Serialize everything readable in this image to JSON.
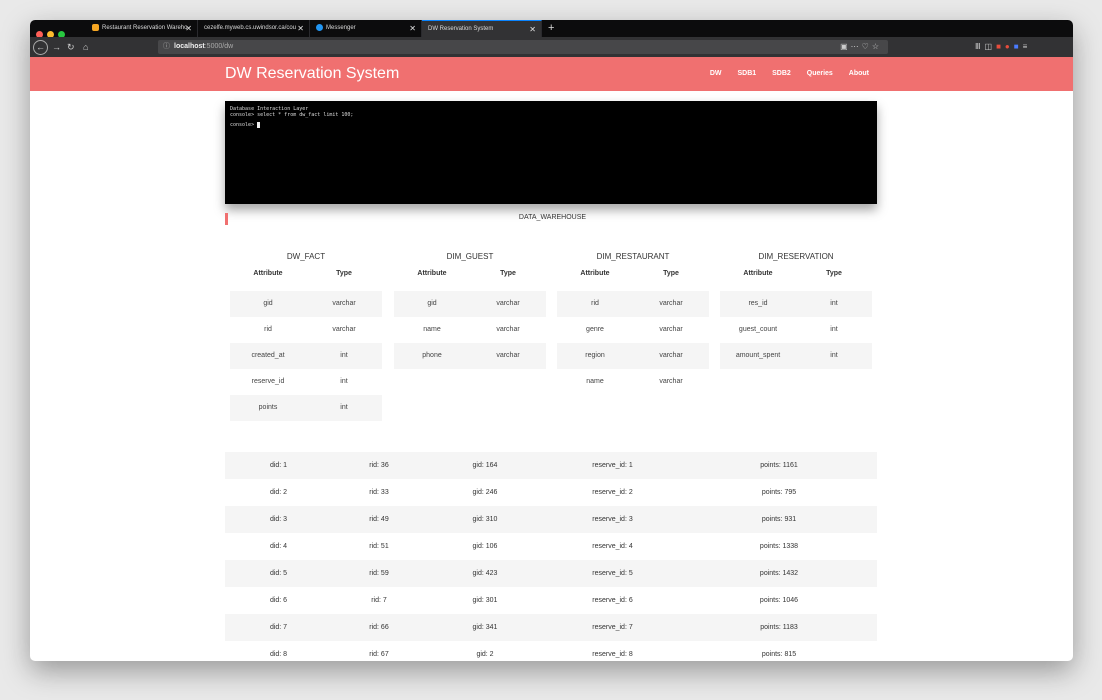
{
  "browser": {
    "tabs": [
      {
        "label": "Restaurant Reservation Wareho",
        "favicon_color": "#f5a623"
      },
      {
        "label": "cezelfe.myweb.cs.uwindsor.ca/cou",
        "favicon_color": ""
      },
      {
        "label": "Messenger",
        "favicon_color": "#2196f3"
      },
      {
        "label": "DW Reservation System",
        "favicon_color": ""
      }
    ],
    "new_tab_label": "+",
    "url_host": "localhost",
    "url_rest": ":5000/dw"
  },
  "site": {
    "brand": "DW Reservation System",
    "nav": [
      "DW",
      "SDB1",
      "SDB2",
      "Queries",
      "About"
    ],
    "accent": "#f07070"
  },
  "console": {
    "header": "Database Interaction Layer",
    "command": "console> select * from dw_fact limit 100;",
    "prompt": "console>"
  },
  "warehouse_title": "DATA_WAREHOUSE",
  "schemas": [
    {
      "name": "DW_FACT",
      "col_attr": "Attribute",
      "col_type": "Type",
      "rows": [
        {
          "attr": "gid",
          "type": "varchar"
        },
        {
          "attr": "rid",
          "type": "varchar"
        },
        {
          "attr": "created_at",
          "type": "int"
        },
        {
          "attr": "reserve_id",
          "type": "int"
        },
        {
          "attr": "points",
          "type": "int"
        }
      ]
    },
    {
      "name": "DIM_GUEST",
      "col_attr": "Attribute",
      "col_type": "Type",
      "rows": [
        {
          "attr": "gid",
          "type": "varchar"
        },
        {
          "attr": "name",
          "type": "varchar"
        },
        {
          "attr": "phone",
          "type": "varchar"
        }
      ]
    },
    {
      "name": "DIM_RESTAURANT",
      "col_attr": "Attribute",
      "col_type": "Type",
      "rows": [
        {
          "attr": "rid",
          "type": "varchar"
        },
        {
          "attr": "genre",
          "type": "varchar"
        },
        {
          "attr": "region",
          "type": "varchar"
        },
        {
          "attr": "name",
          "type": "varchar"
        }
      ]
    },
    {
      "name": "DIM_RESERVATION",
      "col_attr": "Attribute",
      "col_type": "Type",
      "rows": [
        {
          "attr": "res_id",
          "type": "int"
        },
        {
          "attr": "guest_count",
          "type": "int"
        },
        {
          "attr": "amount_spent",
          "type": "int"
        }
      ]
    }
  ],
  "facts": [
    {
      "did": "did: 1",
      "rid": "rid: 36",
      "gid": "gid: 164",
      "reserve": "reserve_id: 1",
      "points": "points: 1161"
    },
    {
      "did": "did: 2",
      "rid": "rid: 33",
      "gid": "gid: 246",
      "reserve": "reserve_id: 2",
      "points": "points: 795"
    },
    {
      "did": "did: 3",
      "rid": "rid: 49",
      "gid": "gid: 310",
      "reserve": "reserve_id: 3",
      "points": "points: 931"
    },
    {
      "did": "did: 4",
      "rid": "rid: 51",
      "gid": "gid: 106",
      "reserve": "reserve_id: 4",
      "points": "points: 1338"
    },
    {
      "did": "did: 5",
      "rid": "rid: 59",
      "gid": "gid: 423",
      "reserve": "reserve_id: 5",
      "points": "points: 1432"
    },
    {
      "did": "did: 6",
      "rid": "rid: 7",
      "gid": "gid: 301",
      "reserve": "reserve_id: 6",
      "points": "points: 1046"
    },
    {
      "did": "did: 7",
      "rid": "rid: 66",
      "gid": "gid: 341",
      "reserve": "reserve_id: 7",
      "points": "points: 1183"
    },
    {
      "did": "did: 8",
      "rid": "rid: 67",
      "gid": "gid: 2",
      "reserve": "reserve_id: 8",
      "points": "points: 815"
    }
  ]
}
